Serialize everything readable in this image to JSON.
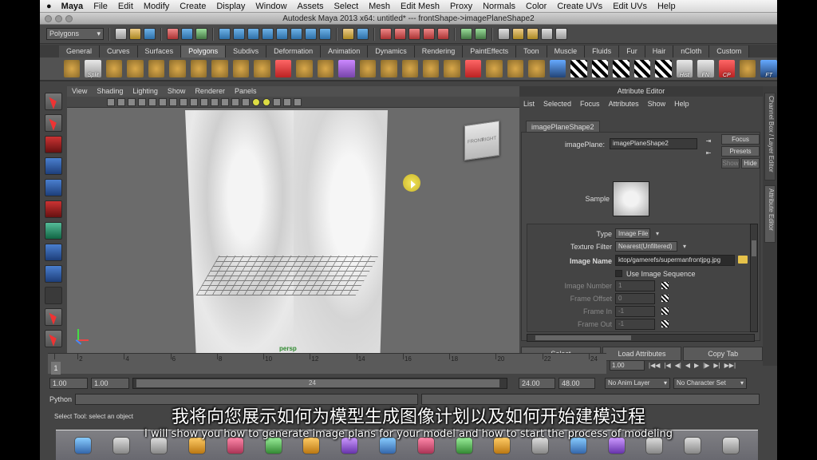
{
  "mac_menu": {
    "app": "Maya",
    "items": [
      "File",
      "Edit",
      "Modify",
      "Create",
      "Display",
      "Window",
      "Assets",
      "Select",
      "Mesh",
      "Edit Mesh",
      "Proxy",
      "Normals",
      "Color",
      "Create UVs",
      "Edit UVs",
      "Help"
    ]
  },
  "window": {
    "title": "Autodesk Maya 2013 x64: untitled*   ---   frontShape->imagePlaneShape2"
  },
  "status_line": {
    "mode": "Polygons"
  },
  "shelf": {
    "tabs": [
      "General",
      "Curves",
      "Surfaces",
      "Polygons",
      "Subdivs",
      "Deformation",
      "Animation",
      "Dynamics",
      "Rendering",
      "PaintEffects",
      "Toon",
      "Muscle",
      "Fluids",
      "Fur",
      "Hair",
      "nCloth",
      "Custom"
    ],
    "active_tab": "Polygons",
    "labels": {
      "split": "Split",
      "hist": "Hist",
      "fn": "FN",
      "cp": "CP",
      "ft": "FT"
    }
  },
  "viewport": {
    "menu": [
      "View",
      "Shading",
      "Lighting",
      "Show",
      "Renderer",
      "Panels"
    ],
    "camera": "persp",
    "cube": {
      "front": "FRONT",
      "right": "RIGHT"
    }
  },
  "attribute_editor": {
    "title": "Attribute Editor",
    "menu": [
      "List",
      "Selected",
      "Focus",
      "Attributes",
      "Show",
      "Help"
    ],
    "tab": "imagePlaneShape2",
    "node_label": "imagePlane:",
    "node_value": "imagePlaneShape2",
    "focus": "Focus",
    "presets": "Presets",
    "show": "Show",
    "hide": "Hide",
    "sample_label": "Sample",
    "type_label": "Type",
    "type_value": "Image File",
    "filter_label": "Texture Filter",
    "filter_value": "Nearest(Unfiltered)",
    "imgname_label": "Image Name",
    "imgname_value": "ktop/gamerefs/supermanfrontjpg.jpg",
    "seq_label": "Use Image Sequence",
    "frame_number_label": "Image Number",
    "frame_number": "1",
    "frame_offset_label": "Frame Offset",
    "frame_offset": "0",
    "frame_in_label": "Frame In",
    "frame_in": "-1",
    "frame_out_label": "Frame Out",
    "frame_out": "-1",
    "buttons": {
      "select": "Select",
      "load": "Load Attributes",
      "copy": "Copy Tab"
    }
  },
  "side_tabs": {
    "channel": "Channel Box / Layer Editor",
    "attr": "Attribute Editor"
  },
  "timeline": {
    "ticks": [
      "1",
      "2",
      "4",
      "6",
      "8",
      "10",
      "12",
      "14",
      "16",
      "18",
      "20",
      "22",
      "24"
    ],
    "current": "1"
  },
  "playback": {
    "frame": "1.00"
  },
  "range": {
    "start": "1.00",
    "start2": "1.00",
    "mid": "24",
    "end1": "24.00",
    "end2": "48.00",
    "anim_layer": "No Anim Layer",
    "char_set": "No Character Set"
  },
  "command": {
    "lang": "Python"
  },
  "help_line": "Select Tool: select an object",
  "subtitles": {
    "zh": "我将向您展示如何为模型生成图像计划以及如何开始建模过程",
    "en": "I will show you how to generate image plans for your model and how to start the process of modeling"
  }
}
